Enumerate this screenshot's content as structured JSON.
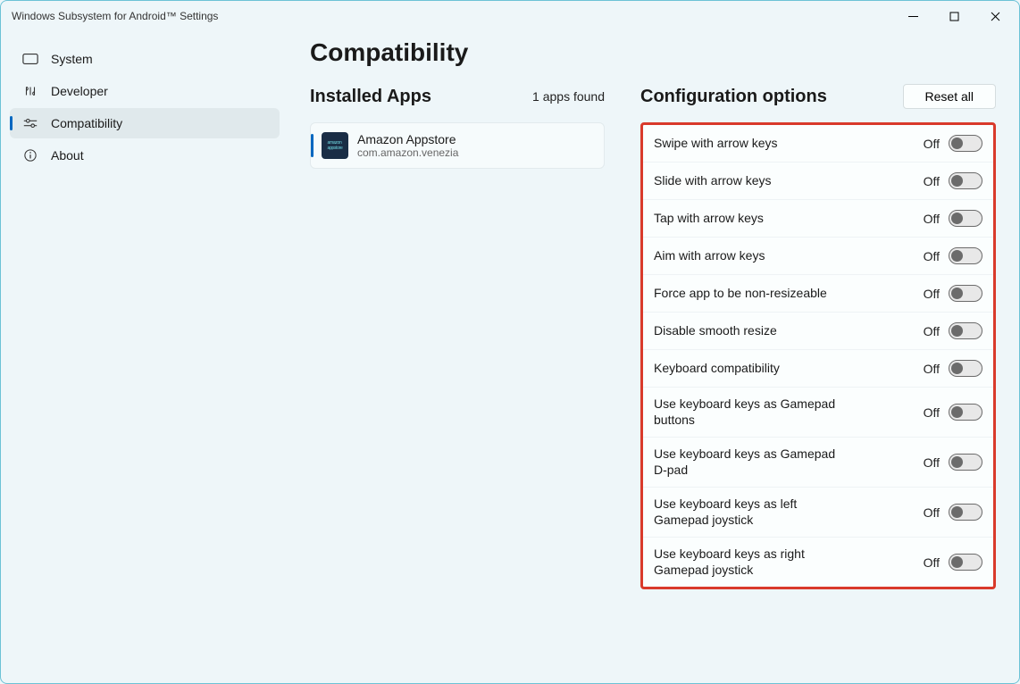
{
  "window": {
    "title": "Windows Subsystem for Android™ Settings"
  },
  "sidebar": {
    "items": [
      {
        "label": "System"
      },
      {
        "label": "Developer"
      },
      {
        "label": "Compatibility"
      },
      {
        "label": "About"
      }
    ]
  },
  "page": {
    "title": "Compatibility"
  },
  "apps": {
    "section_title": "Installed Apps",
    "found_text": "1 apps found",
    "list": [
      {
        "name": "Amazon Appstore",
        "package": "com.amazon.venezia"
      }
    ]
  },
  "config": {
    "section_title": "Configuration options",
    "reset_label": "Reset all",
    "options": [
      {
        "label": "Swipe with arrow keys",
        "state": "Off"
      },
      {
        "label": "Slide with arrow keys",
        "state": "Off"
      },
      {
        "label": "Tap with arrow keys",
        "state": "Off"
      },
      {
        "label": "Aim with arrow keys",
        "state": "Off"
      },
      {
        "label": "Force app to be non-resizeable",
        "state": "Off"
      },
      {
        "label": "Disable smooth resize",
        "state": "Off"
      },
      {
        "label": "Keyboard compatibility",
        "state": "Off"
      },
      {
        "label": "Use keyboard keys as Gamepad buttons",
        "state": "Off"
      },
      {
        "label": "Use keyboard keys as Gamepad D-pad",
        "state": "Off"
      },
      {
        "label": "Use keyboard keys as left Gamepad joystick",
        "state": "Off"
      },
      {
        "label": "Use keyboard keys as right Gamepad joystick",
        "state": "Off"
      }
    ]
  }
}
